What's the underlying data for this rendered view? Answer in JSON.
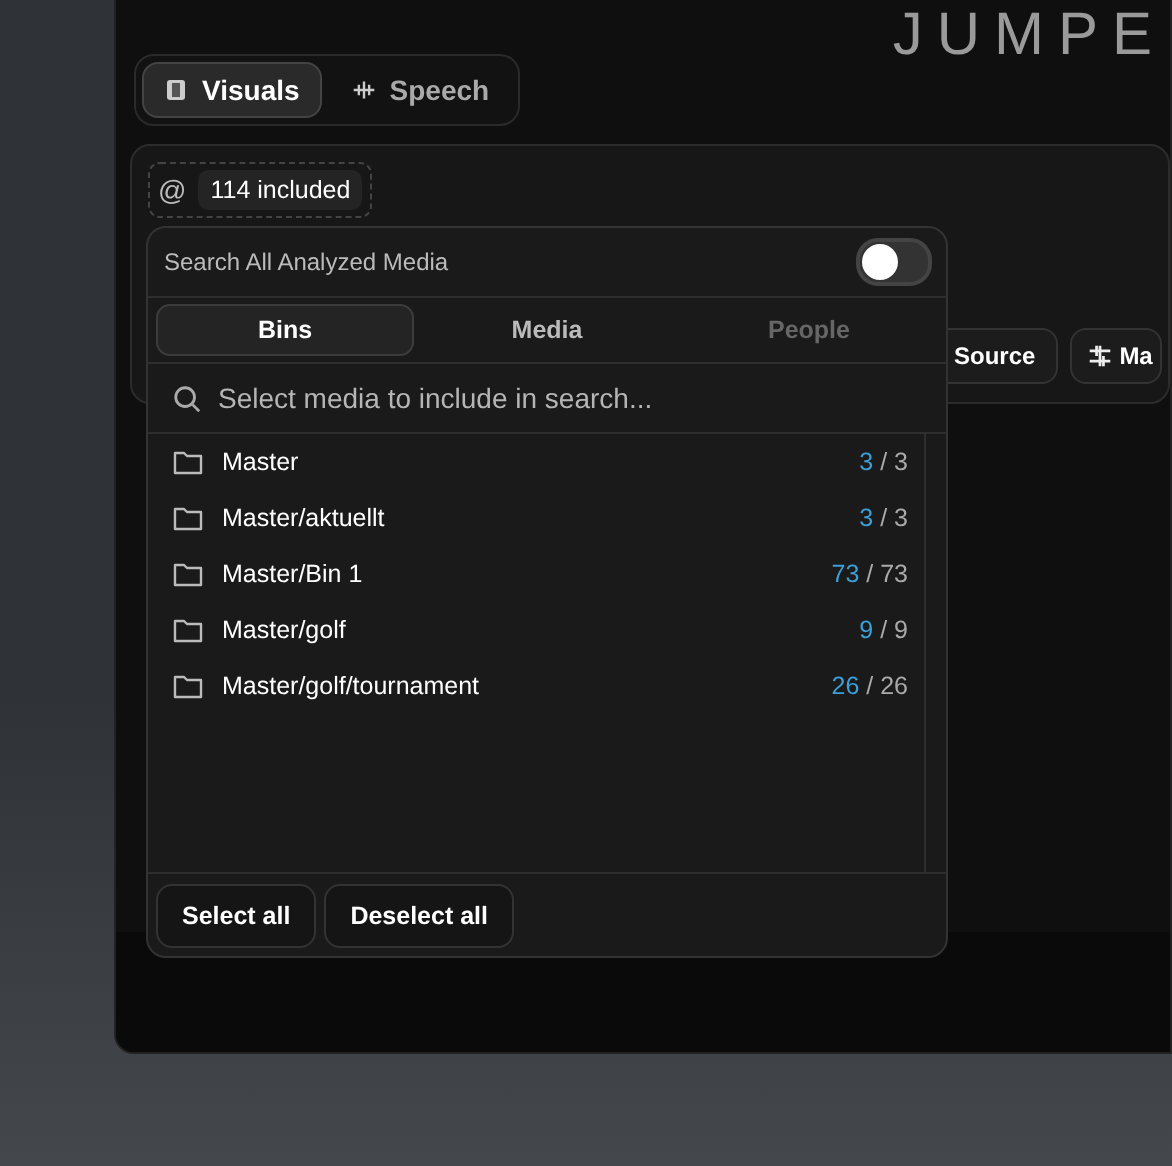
{
  "logo": {
    "text": "JUMPE"
  },
  "mode_tabs": [
    {
      "label": "Visuals",
      "selected": true
    },
    {
      "label": "Speech",
      "selected": false
    }
  ],
  "chip": {
    "symbol": "@",
    "label": "114 included"
  },
  "toolbar_buttons": [
    {
      "label": "Source"
    },
    {
      "label": "Ma"
    }
  ],
  "dropdown": {
    "toggle": {
      "label": "Search All Analyzed Media",
      "on": false
    },
    "tabs": [
      {
        "label": "Bins",
        "selected": true,
        "disabled": false
      },
      {
        "label": "Media",
        "selected": false,
        "disabled": false
      },
      {
        "label": "People",
        "selected": false,
        "disabled": true
      }
    ],
    "search": {
      "placeholder": "Select media to include in search..."
    },
    "bins": [
      {
        "name": "Master",
        "count": "3",
        "total": "/ 3"
      },
      {
        "name": "Master/aktuellt",
        "count": "3",
        "total": "/ 3"
      },
      {
        "name": "Master/Bin 1",
        "count": "73",
        "total": "/ 73"
      },
      {
        "name": "Master/golf",
        "count": "9",
        "total": "/ 9"
      },
      {
        "name": "Master/golf/tournament",
        "count": "26",
        "total": "/ 26"
      }
    ],
    "buttons": [
      "Select all",
      "Deselect all"
    ]
  }
}
